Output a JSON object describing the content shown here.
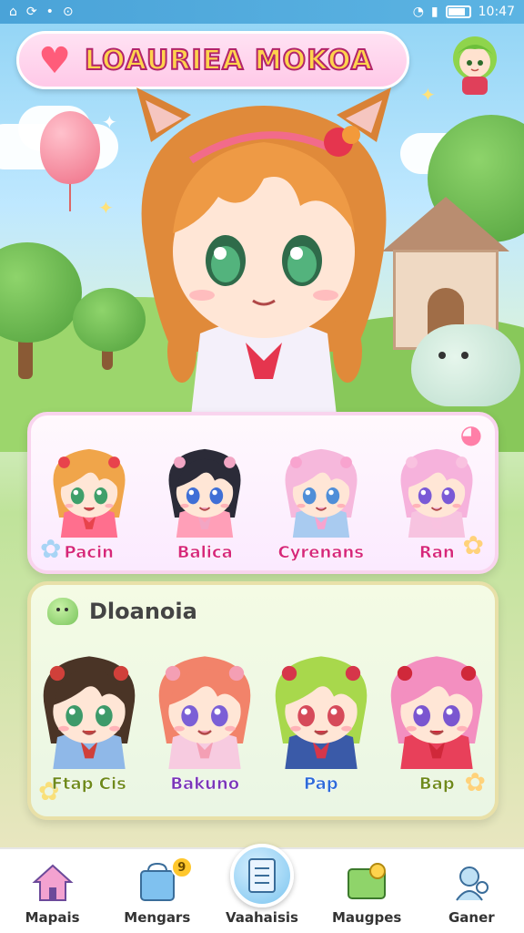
{
  "status_bar": {
    "time": "10:47"
  },
  "header": {
    "title": "LOAURIEA MOKOA"
  },
  "roster_top": {
    "characters": [
      {
        "name": "Pacin",
        "hair": "#f0a54a",
        "eyes": "#3f9f6a",
        "outfit": "#ff6f8e",
        "bow": "#e8434c"
      },
      {
        "name": "Balica",
        "hair": "#2b2b38",
        "eyes": "#3f6fd6",
        "outfit": "#ff9fb8",
        "bow": "#f2a6c4"
      },
      {
        "name": "Cyrenans",
        "hair": "#f6b8dc",
        "eyes": "#4f8ed8",
        "outfit": "#a9cbf0",
        "bow": "#f8a4cf"
      },
      {
        "name": "Ran",
        "hair": "#f6b2dc",
        "eyes": "#7a5ad6",
        "outfit": "#f7c3e0",
        "bow": "#f9c2e0"
      }
    ]
  },
  "roster_bottom": {
    "title": "Dloanoia",
    "characters": [
      {
        "name": "Ftap Cis",
        "hair": "#4a3426",
        "eyes": "#3d9a6a",
        "outfit": "#8fb8e8",
        "bow": "#d0403a"
      },
      {
        "name": "Bakuno",
        "hair": "#f2836a",
        "eyes": "#7b5fd6",
        "outfit": "#f7cbe0",
        "bow": "#f49fb4"
      },
      {
        "name": "Pap",
        "hair": "#a8d84c",
        "eyes": "#d64a5a",
        "outfit": "#3a5aa8",
        "bow": "#d6364a"
      },
      {
        "name": "Bap",
        "hair": "#f38fc0",
        "eyes": "#7a56d0",
        "outfit": "#e8405a",
        "bow": "#d0283a"
      }
    ]
  },
  "bottom_nav": {
    "items": [
      {
        "label": "Mapais",
        "icon": "house-icon",
        "badge": ""
      },
      {
        "label": "Mengars",
        "icon": "shop-icon",
        "badge": "9"
      },
      {
        "label": "Vaahaisis",
        "icon": "notebook-icon",
        "badge": ""
      },
      {
        "label": "Maugpes",
        "icon": "map-icon",
        "badge": ""
      },
      {
        "label": "Ganer",
        "icon": "friends-icon",
        "badge": ""
      }
    ]
  },
  "colors": {
    "title_fill": "#ffd34d",
    "title_stroke": "#b2246b",
    "accent_pink": "#ff5c7a"
  }
}
